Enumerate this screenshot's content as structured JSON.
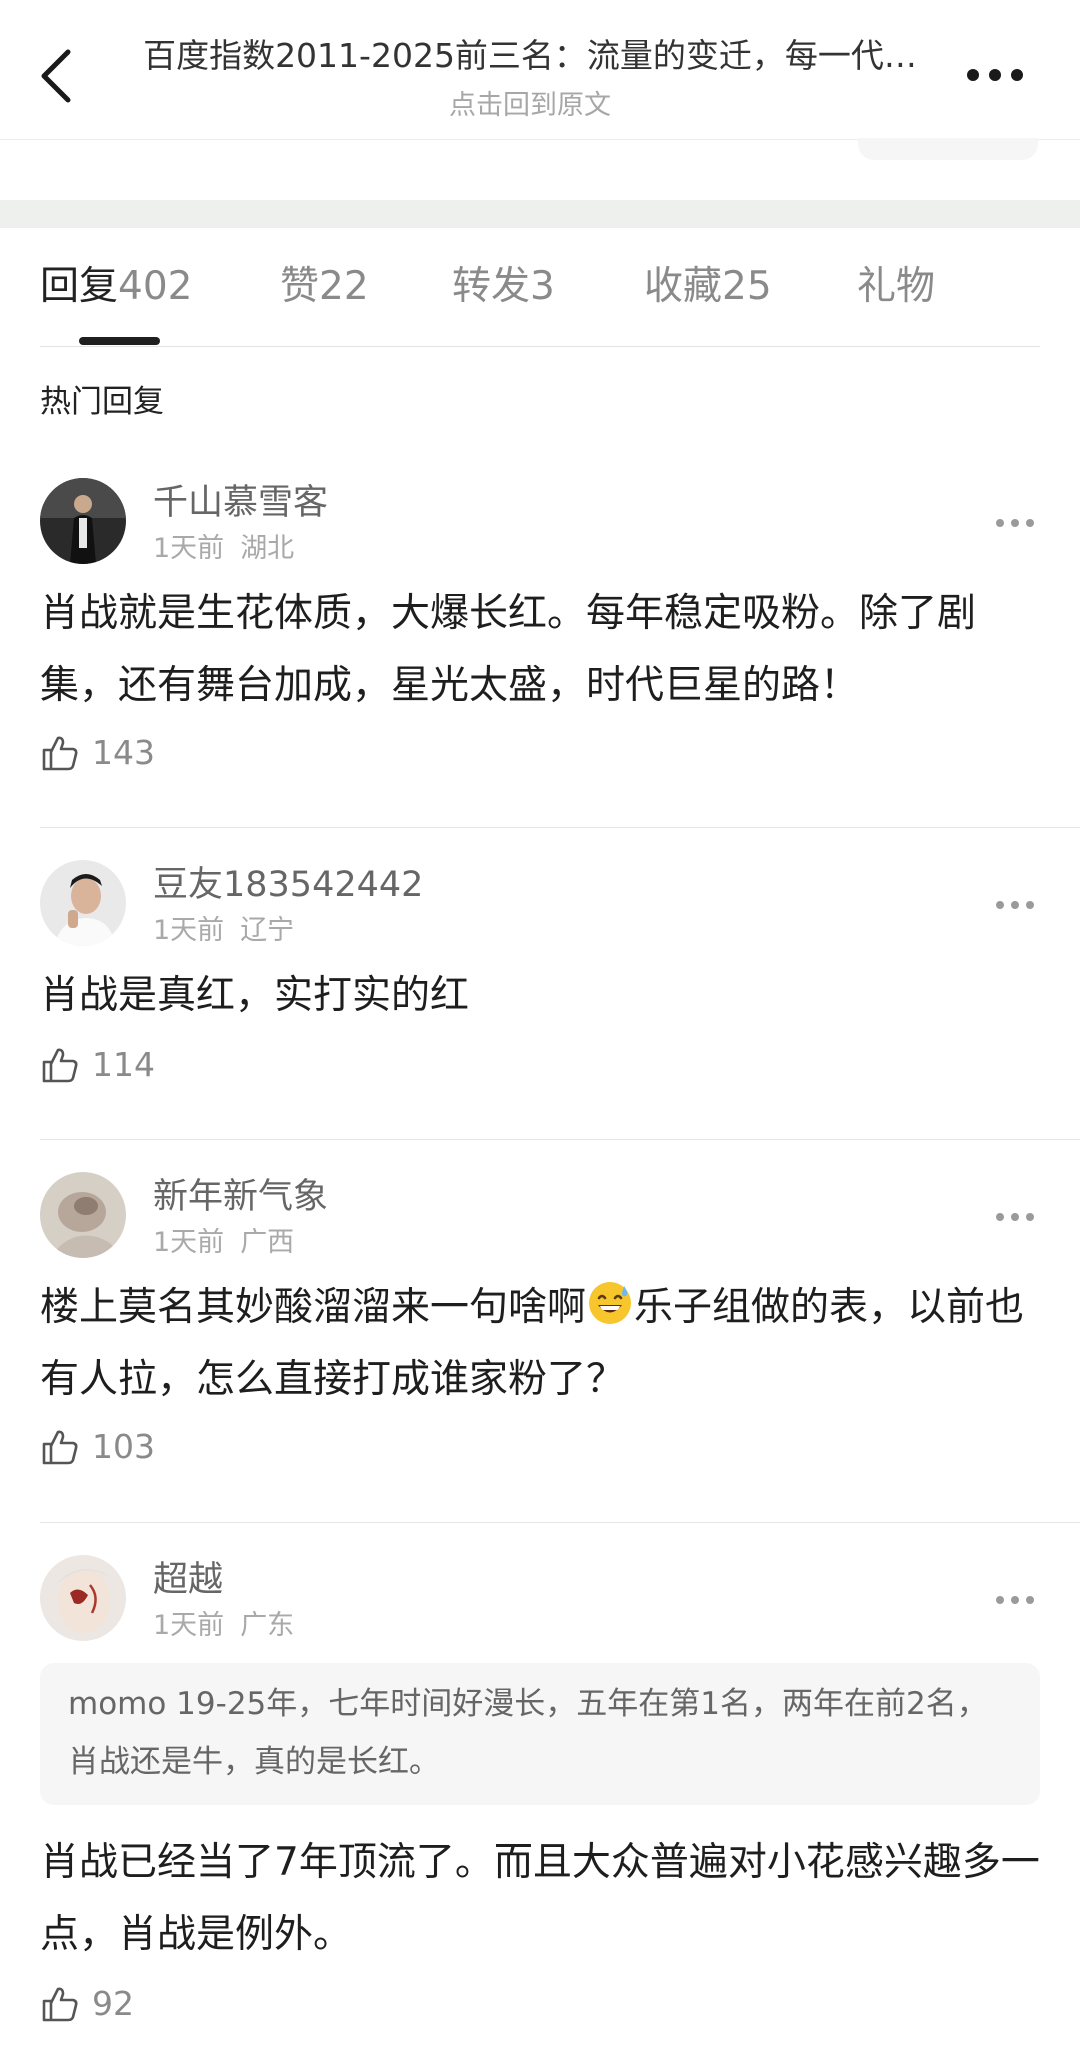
{
  "header": {
    "title": "百度指数2011-2025前三名：流量的变迁，每一代…",
    "subtitle": "点击回到原文"
  },
  "tabs": [
    {
      "label": "回复",
      "count": "402",
      "active": true
    },
    {
      "label": "赞",
      "count": "22"
    },
    {
      "label": "转发",
      "count": "3"
    },
    {
      "label": "收藏",
      "count": "25"
    },
    {
      "label": "礼物",
      "count": ""
    }
  ],
  "section_heading": "热门回复",
  "comments": [
    {
      "user": "千山慕雪客",
      "time": "1天前",
      "location": "湖北",
      "text": "肖战就是生花体质，大爆长红。每年稳定吸粉。除了剧集，还有舞台加成，星光太盛，时代巨星的路！",
      "likes": "143"
    },
    {
      "user": "豆友183542442",
      "time": "1天前",
      "location": "辽宁",
      "text": "肖战是真红，实打实的红",
      "likes": "114"
    },
    {
      "user": "新年新气象",
      "time": "1天前",
      "location": "广西",
      "text_before_emoji": "楼上莫名其妙酸溜溜来一句啥啊",
      "emoji": "grinning-sweat-emoji",
      "text_after_emoji": "乐子组做的表，以前也有人拉，怎么直接打成谁家粉了？",
      "likes": "103"
    },
    {
      "user": "超越",
      "time": "1天前",
      "location": "广东",
      "quote": "momo 19-25年，七年时间好漫长，五年在第1名，两年在前2名，肖战还是牛，真的是长红。",
      "text": "肖战已经当了7年顶流了。而且大众普遍对小花感兴趣多一点，肖战是例外。",
      "likes": "92"
    }
  ],
  "icons": {
    "back": "chevron-left-icon",
    "more": "more-horizontal-icon",
    "like": "thumbs-up-icon",
    "comment_more": "more-dots-icon"
  },
  "colors": {
    "text_primary": "#1e1e1e",
    "text_secondary": "#8a8a8a",
    "separator_band": "#eef0ee",
    "quote_bg": "#f6f6f6"
  }
}
